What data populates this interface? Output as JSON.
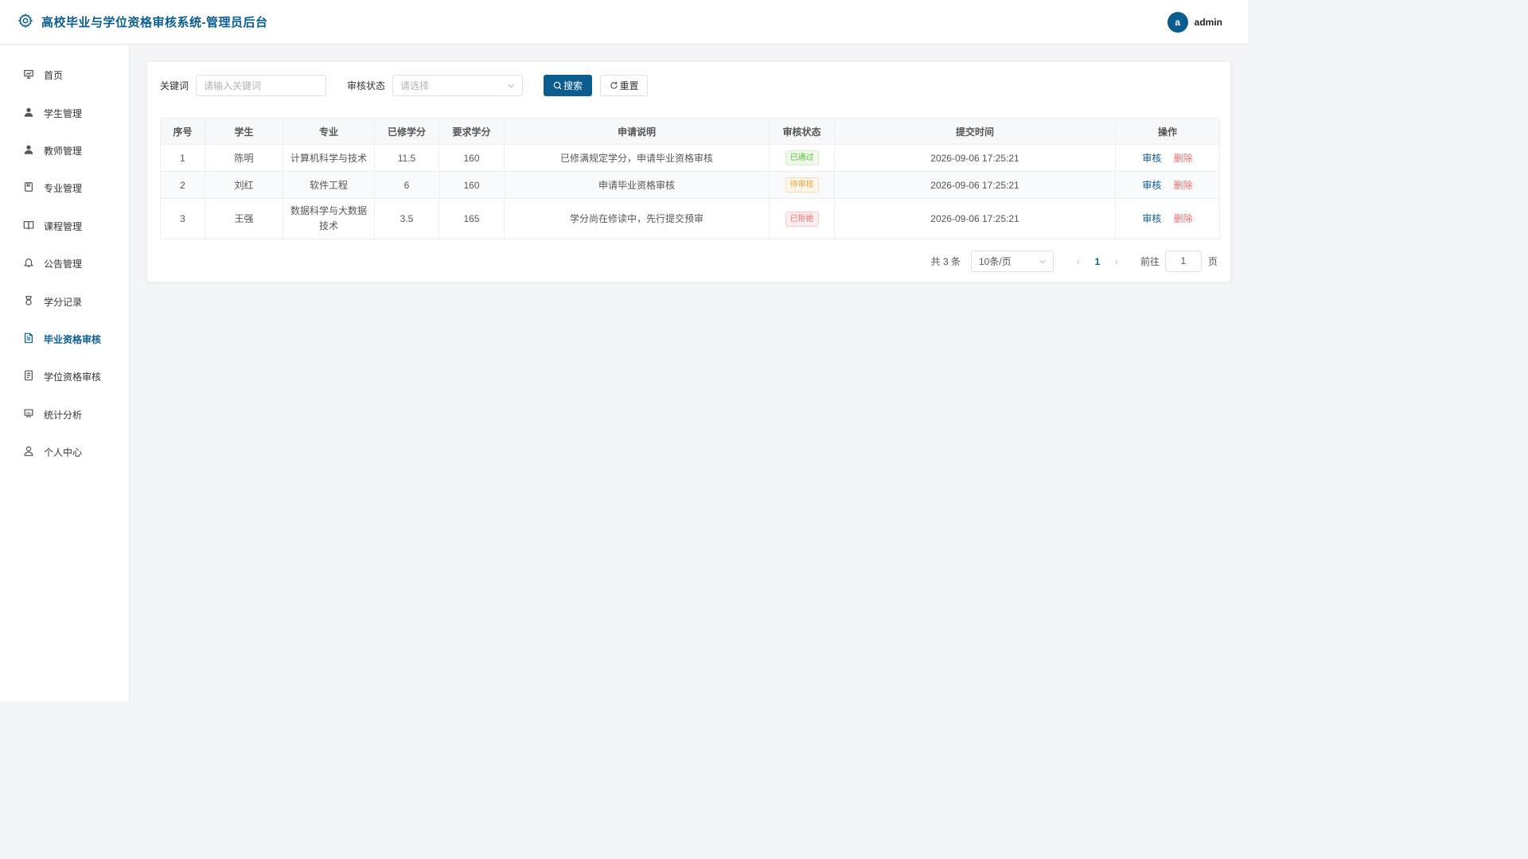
{
  "header": {
    "title": "高校毕业与学位资格审核系统-管理员后台",
    "avatar_letter": "a",
    "username": "admin"
  },
  "sidebar": {
    "items": [
      {
        "label": "首页",
        "icon": "dashboard-icon"
      },
      {
        "label": "学生管理",
        "icon": "user-filled-icon"
      },
      {
        "label": "教师管理",
        "icon": "user-filled-icon"
      },
      {
        "label": "专业管理",
        "icon": "notebook-icon"
      },
      {
        "label": "课程管理",
        "icon": "book-icon"
      },
      {
        "label": "公告管理",
        "icon": "bell-icon"
      },
      {
        "label": "学分记录",
        "icon": "medal-icon"
      },
      {
        "label": "毕业资格审核",
        "icon": "document-icon",
        "active": true
      },
      {
        "label": "学位资格审核",
        "icon": "tickets-icon"
      },
      {
        "label": "统计分析",
        "icon": "data-board-icon"
      },
      {
        "label": "个人中心",
        "icon": "user-icon"
      }
    ]
  },
  "filters": {
    "keyword_label": "关键词",
    "keyword_placeholder": "请输入关键词",
    "status_label": "审核状态",
    "status_placeholder": "请选择",
    "search_label": "搜索",
    "reset_label": "重置"
  },
  "table": {
    "columns": [
      "序号",
      "学生",
      "专业",
      "已修学分",
      "要求学分",
      "申请说明",
      "审核状态",
      "提交时间",
      "操作"
    ],
    "rows": [
      {
        "index": "1",
        "student": "陈明",
        "major": "计算机科学与技术",
        "earned": "11.5",
        "required": "160",
        "note": "已修满规定学分，申请毕业资格审核",
        "status": "已通过",
        "status_type": "success",
        "time": "2026-09-06 17:25:21"
      },
      {
        "index": "2",
        "student": "刘红",
        "major": "软件工程",
        "earned": "6",
        "required": "160",
        "note": "申请毕业资格审核",
        "status": "待审核",
        "status_type": "warning",
        "time": "2026-09-06 17:25:21"
      },
      {
        "index": "3",
        "student": "王强",
        "major": "数据科学与大数据技术",
        "earned": "3.5",
        "required": "165",
        "note": "学分尚在修读中，先行提交预审",
        "status": "已拒绝",
        "status_type": "danger",
        "time": "2026-09-06 17:25:21"
      }
    ],
    "op_review": "审核",
    "op_delete": "删除"
  },
  "pagination": {
    "total_text": "共 3 条",
    "page_size": "10条/页",
    "current_page": "1",
    "goto_label": "前往",
    "goto_value": "1",
    "page_suffix": "页"
  },
  "colors": {
    "primary": "#0b5c8f",
    "success": "#5bbf3a",
    "warning": "#e6a23c",
    "danger": "#f56c6c"
  }
}
